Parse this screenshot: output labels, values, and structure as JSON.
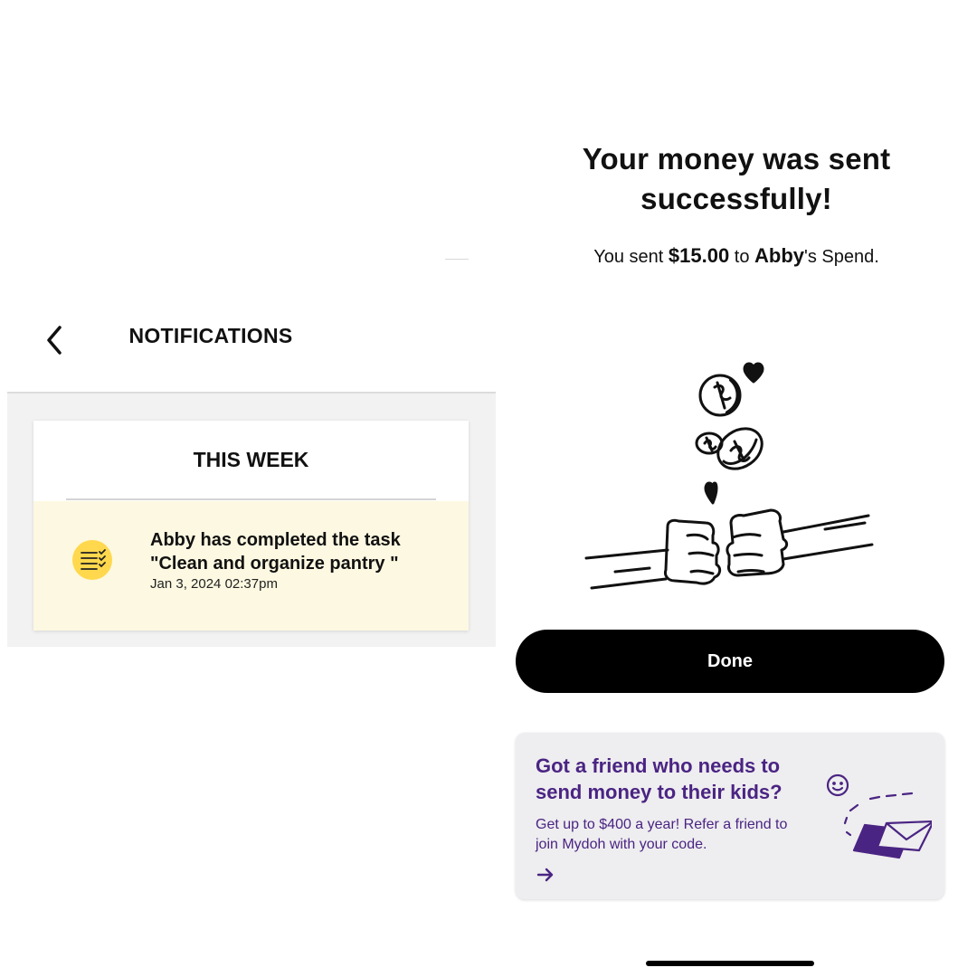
{
  "notifications": {
    "title": "NOTIFICATIONS",
    "section_title": "THIS WEEK",
    "items": [
      {
        "message": "Abby has completed the task \"Clean and organize pantry \"",
        "timestamp": "Jan 3, 2024 02:37pm",
        "icon": "task-checklist-icon"
      }
    ],
    "icons": {
      "back": "chevron-left-icon"
    }
  },
  "success": {
    "title": "Your money was sent successfully!",
    "sub_prefix": "You sent ",
    "amount": "$15.00",
    "sub_middle": " to ",
    "recipient": "Abby",
    "sub_suffix": "'s Spend.",
    "illustration": "fist-bump-coins-illustration",
    "done_label": "Done"
  },
  "promo": {
    "title": "Got a friend who needs to send money to their kids?",
    "body": "Get up to $400 a year! Refer a friend to join Mydoh with your code.",
    "arrow_icon": "arrow-right-icon",
    "illustration": "envelope-send-illustration"
  },
  "colors": {
    "notification_bg": "#fdf8e1",
    "task_icon_bg": "#ffd84d",
    "promo_text": "#4a2483",
    "promo_bg": "#eeedef",
    "button_bg": "#000000"
  }
}
